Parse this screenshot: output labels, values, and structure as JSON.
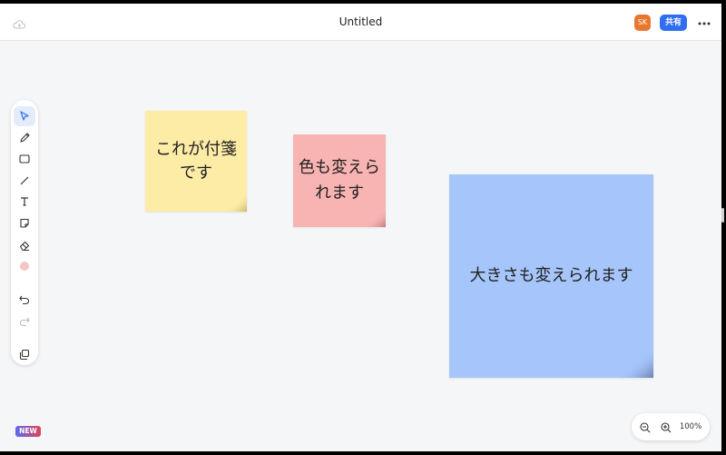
{
  "header": {
    "title": "Untitled",
    "avatar_initials": "SK",
    "share_label": "共有",
    "icons": {
      "cloud": "cloud-icon",
      "more": "more-horizontal-icon"
    }
  },
  "toolbar": {
    "tools": [
      {
        "name": "select",
        "icon": "cursor-arrow-icon",
        "active": true
      },
      {
        "name": "pen",
        "icon": "pencil-icon"
      },
      {
        "name": "rectangle",
        "icon": "rectangle-icon"
      },
      {
        "name": "line",
        "icon": "line-icon"
      },
      {
        "name": "text",
        "icon": "text-icon"
      },
      {
        "name": "sticky-note",
        "icon": "sticky-note-icon"
      },
      {
        "name": "eraser",
        "icon": "eraser-icon"
      },
      {
        "name": "color",
        "icon": "color-dot-icon",
        "color": "#f6c7c2"
      },
      {
        "name": "undo",
        "icon": "undo-icon"
      },
      {
        "name": "redo",
        "icon": "redo-icon",
        "disabled": true
      },
      {
        "name": "pages",
        "icon": "layers-icon"
      }
    ]
  },
  "notes": [
    {
      "text": "これが付箋\nです",
      "color": "#fdeca6"
    },
    {
      "text": "色も変えら\nれます",
      "color": "#f8b4b3"
    },
    {
      "text": "大きさも変えられます",
      "color": "#a6c6fb"
    }
  ],
  "badge": {
    "new_label": "NEW"
  },
  "zoom": {
    "level": "100%"
  },
  "colors": {
    "accent": "#2f6ef0",
    "avatar": "#e8772e",
    "canvas": "#f5f6f8"
  }
}
